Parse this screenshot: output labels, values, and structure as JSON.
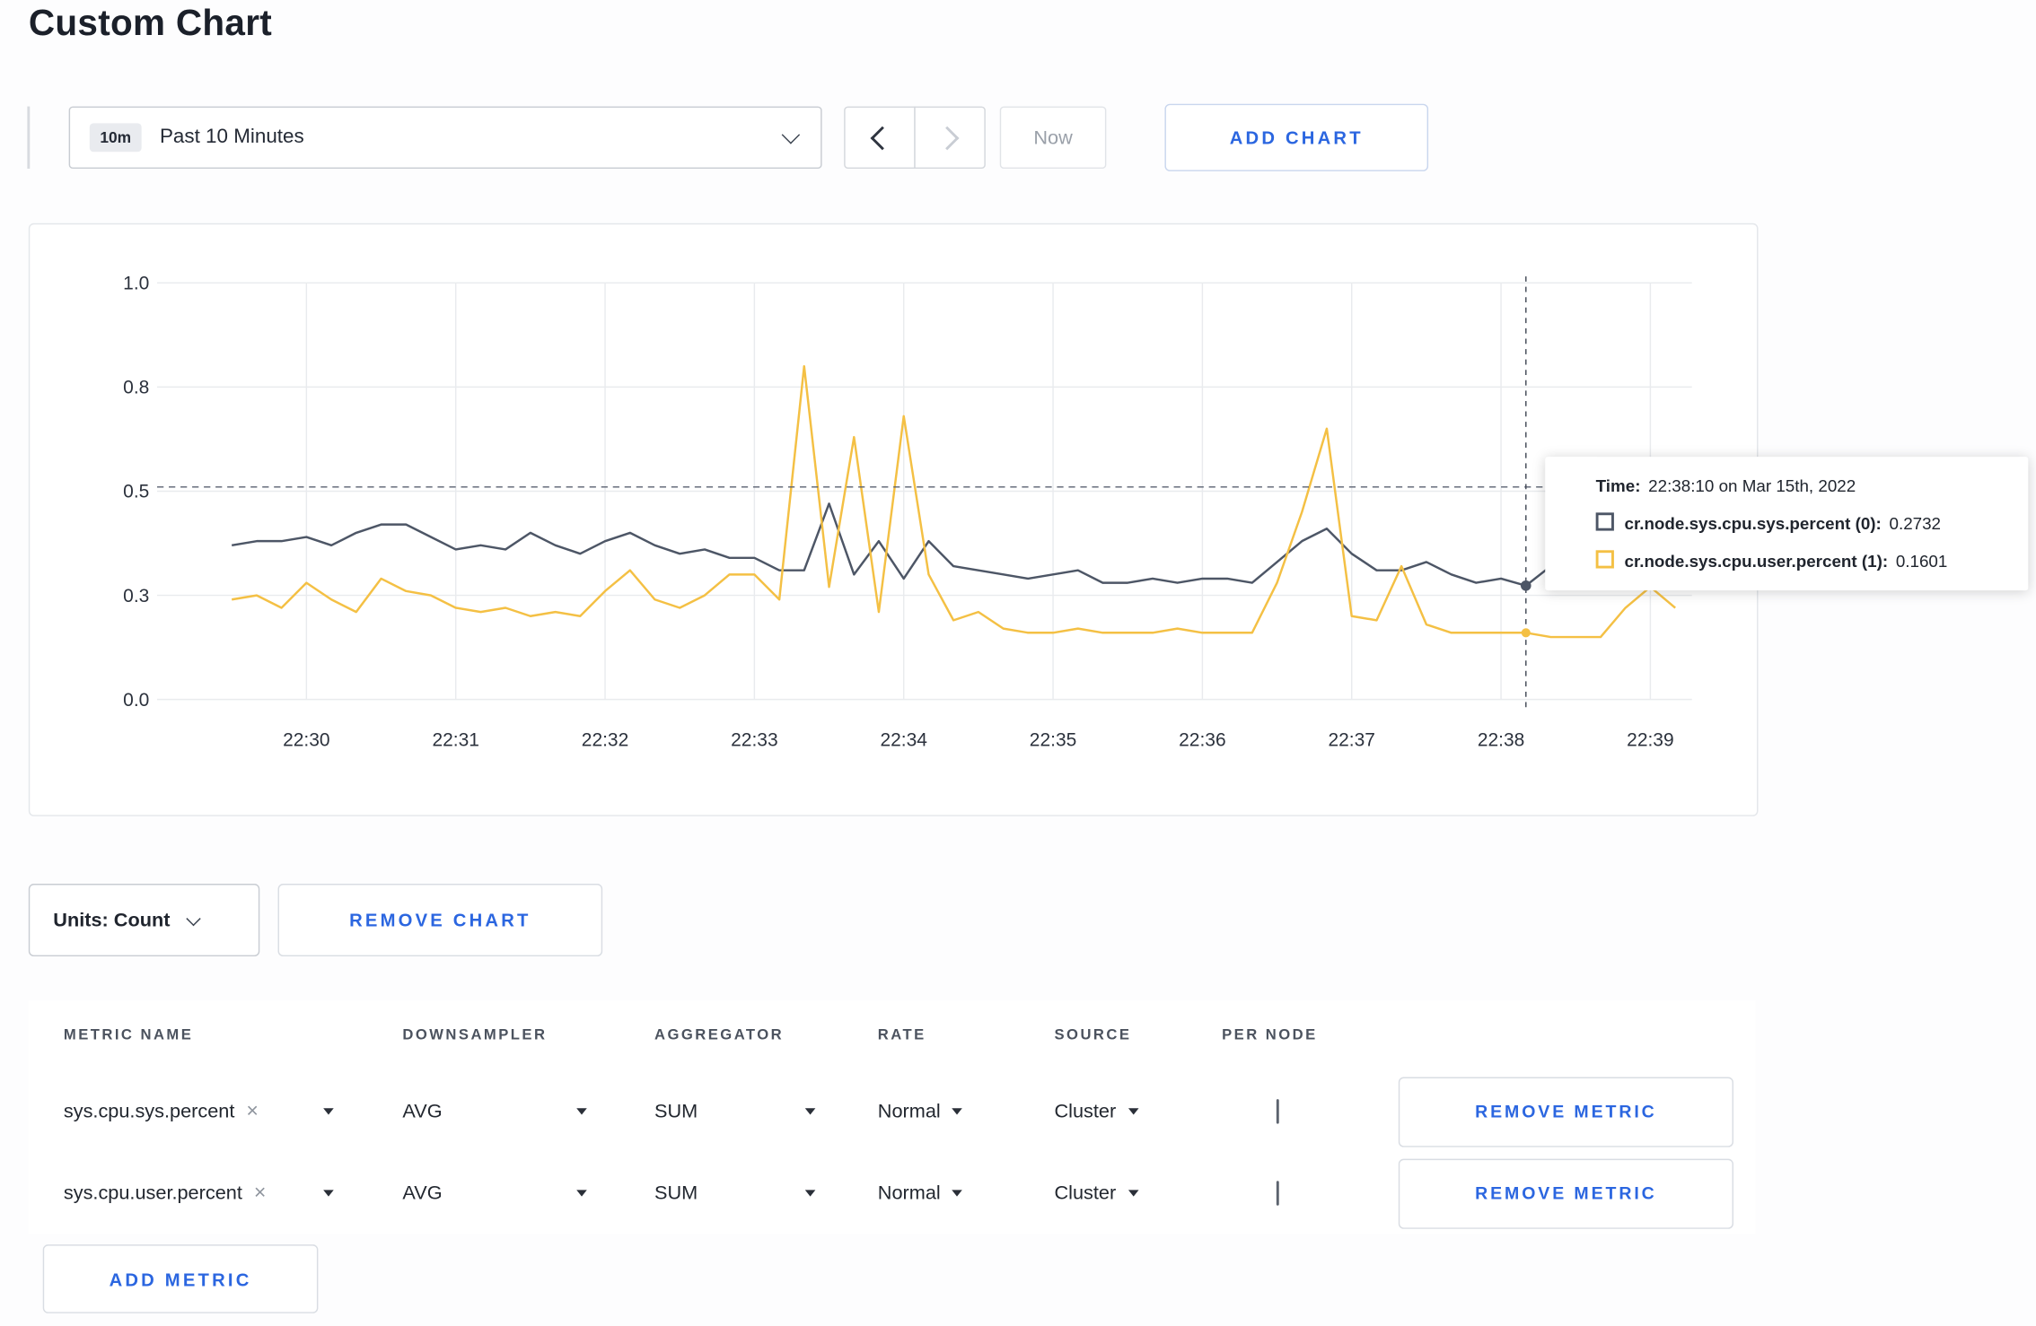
{
  "page": {
    "title": "Custom Chart"
  },
  "toolbar": {
    "time_badge": "10m",
    "time_range_label": "Past 10 Minutes",
    "now_label": "Now",
    "add_chart_label": "ADD CHART"
  },
  "colors": {
    "accent_blue": "#2b66e0",
    "series_sys": "#4d5666",
    "series_user": "#f4c044"
  },
  "icons": {
    "clear": "×"
  },
  "chart_data": {
    "type": "line",
    "title": "",
    "xlabel": "",
    "ylabel": "",
    "ylim": [
      0,
      1
    ],
    "x_ticks": [
      "22:30",
      "22:31",
      "22:32",
      "22:33",
      "22:34",
      "22:35",
      "22:36",
      "22:37",
      "22:38",
      "22:39"
    ],
    "y_tick_values": [
      0,
      0.25,
      0.5,
      0.75,
      1.0
    ],
    "y_tick_labels": [
      "0.0",
      "0.3",
      "0.5",
      "0.8",
      "1.0"
    ],
    "x_start": "22:29:30",
    "x_step_seconds": 10,
    "grid": true,
    "legend_position": "none",
    "series": [
      {
        "name": "cr.node.sys.cpu.sys.percent",
        "color": "#4d5666",
        "values": [
          0.37,
          0.38,
          0.38,
          0.39,
          0.37,
          0.4,
          0.42,
          0.42,
          0.39,
          0.36,
          0.37,
          0.36,
          0.4,
          0.37,
          0.35,
          0.38,
          0.4,
          0.37,
          0.35,
          0.36,
          0.34,
          0.34,
          0.31,
          0.31,
          0.47,
          0.3,
          0.38,
          0.29,
          0.38,
          0.32,
          0.31,
          0.3,
          0.29,
          0.3,
          0.31,
          0.28,
          0.28,
          0.29,
          0.28,
          0.29,
          0.29,
          0.28,
          0.33,
          0.38,
          0.41,
          0.35,
          0.31,
          0.31,
          0.33,
          0.3,
          0.28,
          0.29,
          0.2732,
          0.32,
          0.3,
          0.3,
          0.31,
          0.3,
          0.31
        ]
      },
      {
        "name": "cr.node.sys.cpu.user.percent",
        "color": "#f4c044",
        "values": [
          0.24,
          0.25,
          0.22,
          0.28,
          0.24,
          0.21,
          0.29,
          0.26,
          0.25,
          0.22,
          0.21,
          0.22,
          0.2,
          0.21,
          0.2,
          0.26,
          0.31,
          0.24,
          0.22,
          0.25,
          0.3,
          0.3,
          0.24,
          0.8,
          0.27,
          0.63,
          0.21,
          0.68,
          0.3,
          0.19,
          0.21,
          0.17,
          0.16,
          0.16,
          0.17,
          0.16,
          0.16,
          0.16,
          0.17,
          0.16,
          0.16,
          0.16,
          0.28,
          0.45,
          0.65,
          0.2,
          0.19,
          0.32,
          0.18,
          0.16,
          0.16,
          0.16,
          0.1601,
          0.15,
          0.15,
          0.15,
          0.22,
          0.27,
          0.22
        ]
      }
    ],
    "crosshair": {
      "time": "22:38:10",
      "hline_value": 0.51,
      "point_values": [
        0.2732,
        0.1601
      ]
    }
  },
  "tooltip": {
    "time_label": "Time:",
    "time_value": "22:38:10 on Mar 15th, 2022",
    "series": [
      {
        "name": "cr.node.sys.cpu.sys.percent (0):",
        "value": "0.2732",
        "color": "#4d5666"
      },
      {
        "name": "cr.node.sys.cpu.user.percent (1):",
        "value": "0.1601",
        "color": "#f4c044"
      }
    ]
  },
  "chart_controls": {
    "units_label": "Units: Count",
    "remove_chart_label": "REMOVE CHART"
  },
  "metrics_table": {
    "headers": [
      "METRIC NAME",
      "DOWNSAMPLER",
      "AGGREGATOR",
      "RATE",
      "SOURCE",
      "PER NODE"
    ],
    "rows": [
      {
        "metric": "sys.cpu.sys.percent",
        "downsampler": "AVG",
        "aggregator": "SUM",
        "rate": "Normal",
        "source": "Cluster",
        "per_node_checked": false,
        "remove_label": "REMOVE METRIC"
      },
      {
        "metric": "sys.cpu.user.percent",
        "downsampler": "AVG",
        "aggregator": "SUM",
        "rate": "Normal",
        "source": "Cluster",
        "per_node_checked": false,
        "remove_label": "REMOVE METRIC"
      }
    ],
    "add_metric_label": "ADD METRIC"
  }
}
